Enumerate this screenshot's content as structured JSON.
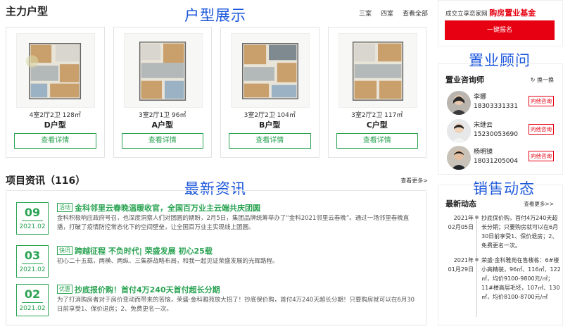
{
  "overlays": {
    "floorplans": "户型展示",
    "advisor": "置业顾问",
    "news": "最新资讯",
    "sales": "销售动态"
  },
  "floorplans": {
    "title": "主力户型",
    "filters": [
      "三室",
      "四室",
      "查看全部"
    ],
    "cards": [
      {
        "spec": "4室2厅2卫 128㎡",
        "name": "D户型",
        "button": "查看详情"
      },
      {
        "spec": "3室2厅1卫 96㎡",
        "name": "A户型",
        "button": "查看详情"
      },
      {
        "spec": "3室2厅2卫 104㎡",
        "name": "B户型",
        "button": "查看详情"
      },
      {
        "spec": "3室2厅2卫 117㎡",
        "name": "C户型",
        "button": "查看详情"
      }
    ]
  },
  "news": {
    "title": "项目资讯（116）",
    "more": "查看更多>",
    "items": [
      {
        "day": "09",
        "ym": "2021.02",
        "tag": "活动",
        "headline": "金科邻里云春晚温暖收官，全国百万业主云端共庆团圆",
        "body": "金科积极响应政府号召，也深度洞察人们对团圆的期盼，2月5日，集团品牌统筹举办了“金科2021邻里云春晚”。通过一场邻里春晚直播，打破了疫情防控常态化下的空间壁垒，让全国百万业主实现线上团圆。"
      },
      {
        "day": "03",
        "ym": "2021.02",
        "tag": "快讯",
        "headline": "跨越征程 不负时代| 荣盛发展 初心25载",
        "body": "初心二十五载，两横、两纵、三集群战略布局，和我一起见证荣盛发展的光辉路程。"
      },
      {
        "day": "02",
        "ym": "2021.02",
        "tag": "优惠",
        "headline": "抄底报价购！首付4万240天首付超长分期",
        "body": "为了打消购房者对于房价变动而带来的苦恼，荣盛·金科雅苑放大招了！抄底保价购，首付4万240天超长分期！只要购房就可以在6月30日前享受1、保价退房；2、免费更名一次。"
      }
    ]
  },
  "fund": {
    "text": "成交立享恋家网",
    "highlight": "购房置业基金",
    "button": "一键报名"
  },
  "advisor": {
    "title": "置业咨询师",
    "refresh": "换一换",
    "list": [
      {
        "name": "李娜",
        "phone": "18303331331",
        "button": "向他咨询"
      },
      {
        "name": "宋继云",
        "phone": "15230053690",
        "button": "向他咨询"
      },
      {
        "name": "杨明镜",
        "phone": "18031205004",
        "button": "向他咨询"
      }
    ]
  },
  "sales": {
    "title": "最新动态",
    "more": "查看更多>>",
    "items": [
      {
        "year": "2021年",
        "date": "02月05日",
        "text": "抄底保价购，首付4万240天超长分期；只要购房就可以在6月30日前享受1、保价退房；2、免费更名一次。"
      },
      {
        "year": "2021年",
        "date": "01月29日",
        "text": "荣盛·金科雅苑在售楼栋：6#楼小高精装，96㎡、116㎡、122㎡，均价9100-9800元/㎡；11#楼高层毛坯，107㎡、130㎡，均价8100-8700元/㎡"
      }
    ]
  },
  "colors": {
    "green": "#2aa352",
    "red": "#e60012",
    "blue_overlay": "#1a56db"
  }
}
